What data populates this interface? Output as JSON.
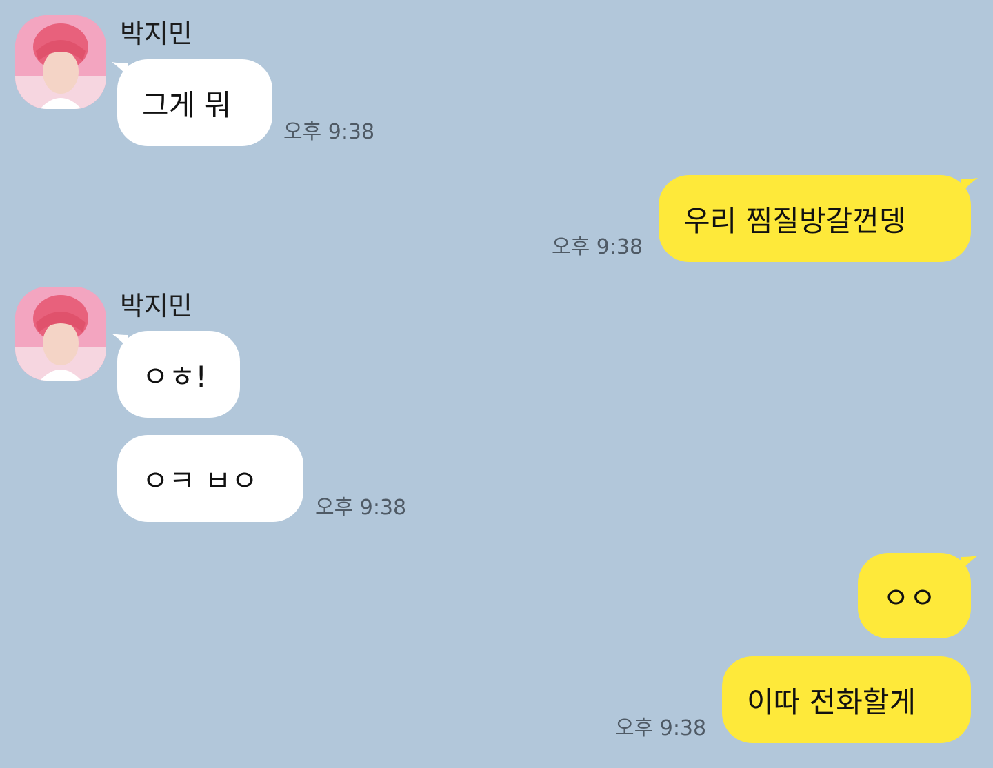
{
  "colors": {
    "background": "#b2c7da",
    "incoming_bubble": "#ffffff",
    "outgoing_bubble": "#fee93a",
    "time_text": "#4f5a65"
  },
  "chat": {
    "sender_name": "박지민",
    "messages": [
      {
        "from": "other",
        "text": "그게 뭐",
        "time": "오후 9:38"
      },
      {
        "from": "me",
        "text": "우리 찜질방갈껀뎅",
        "time": "오후 9:38"
      },
      {
        "from": "other",
        "text": "ㅇㅎ!"
      },
      {
        "from": "other",
        "text": "ㅇㅋ ㅂㅇ",
        "time": "오후 9:38"
      },
      {
        "from": "me",
        "text": "ㅇㅇ"
      },
      {
        "from": "me",
        "text": "이따 전화할게",
        "time": "오후 9:38"
      }
    ]
  },
  "icons": {
    "avatar": "profile-photo-avatar"
  }
}
